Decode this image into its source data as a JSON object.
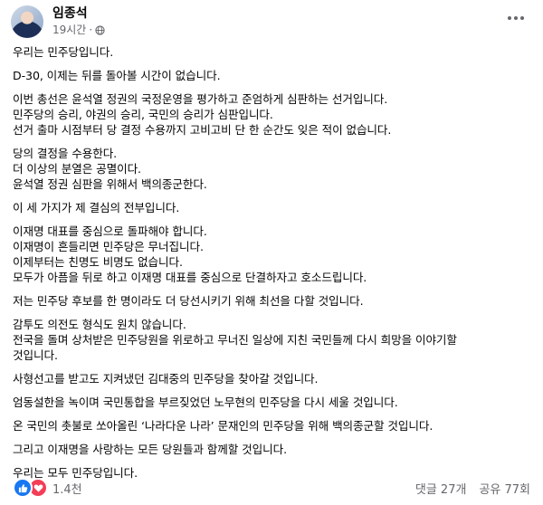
{
  "post": {
    "author": "임종석",
    "time": "19시간",
    "separator": "·"
  },
  "body": {
    "paragraphs": [
      [
        "우리는 민주당입니다."
      ],
      [
        "D-30, 이제는 뒤를 돌아볼 시간이 없습니다."
      ],
      [
        "이번 총선은 윤석열 정권의 국정운영을 평가하고 준엄하게 심판하는 선거입니다.",
        "민주당의 승리, 야권의 승리, 국민의 승리가 심판입니다.",
        "선거 출마 시점부터 당 결정 수용까지 고비고비 단 한 순간도 잊은 적이 없습니다."
      ],
      [
        "당의 결정을 수용한다.",
        "더 이상의 분열은 공멸이다.",
        "윤석열 정권 심판을 위해서 백의종군한다."
      ],
      [
        "이 세 가지가 제 결심의 전부입니다."
      ],
      [
        "이재명 대표를 중심으로 돌파해야 합니다.",
        "이재명이 흔들리면 민주당은 무너집니다.",
        "이제부터는 친명도 비명도 없습니다.",
        "모두가 아픔을 뒤로 하고 이재명 대표를 중심으로 단결하자고 호소드립니다."
      ],
      [
        "저는 민주당 후보를 한 명이라도 더 당선시키기 위해 최선을 다할 것입니다."
      ],
      [
        "감투도 의전도 형식도 원치 않습니다.",
        "전국을 돌며 상처받은 민주당원을 위로하고 무너진 일상에 지친 국민들께 다시 희망을 이야기할",
        "것입니다."
      ],
      [
        "사형선고를 받고도 지켜냈던 김대중의 민주당을 찾아갈 것입니다."
      ],
      [
        "엄동설한을 녹이며 국민통합을 부르짖었던 노무현의 민주당을 다시 세울 것입니다."
      ],
      [
        "온 국민의 촛불로 쏘아올린 ‘나라다운 나라’ 문재인의 민주당을 위해 백의종군할 것입니다."
      ],
      [
        "그리고 이재명을 사랑하는 모든 당원들과 함께할 것입니다."
      ],
      [
        "우리는 모두 민주당입니다."
      ]
    ]
  },
  "footer": {
    "reaction_count": "1.4천",
    "comments": "댓글 27개",
    "shares": "공유 77회"
  },
  "colors": {
    "like": "#1877f2",
    "love": "#f33e58",
    "secondary_text": "#65676b"
  }
}
